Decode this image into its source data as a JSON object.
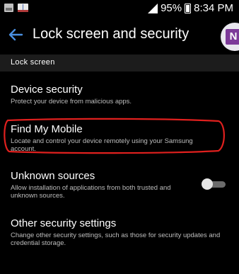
{
  "status_bar": {
    "battery_percent": "95%",
    "time": "8:34 PM",
    "icons": [
      "photo-icon",
      "book-icon",
      "signal-icon",
      "battery-icon"
    ]
  },
  "header": {
    "title": "Lock screen and security"
  },
  "overlay_app": {
    "letter": "N",
    "icon": "onenote-icon",
    "color": "#7d3a99"
  },
  "section": {
    "label": "Lock screen"
  },
  "items": [
    {
      "title": "Device security",
      "description": "Protect your device from malicious apps."
    },
    {
      "title": "Find My Mobile",
      "description": "Locate and control your device remotely using your Samsung account."
    },
    {
      "title": "Unknown sources",
      "description": "Allow installation of applications from both trusted and unknown sources.",
      "toggle_on": false
    },
    {
      "title": "Other security settings",
      "description": "Change other security settings, such as those for security updates and credential storage."
    }
  ],
  "colors": {
    "background": "#000000",
    "accent": "#4a8fe0",
    "highlight_annotation": "#e0201e",
    "section_bg": "#1c1c1c"
  }
}
